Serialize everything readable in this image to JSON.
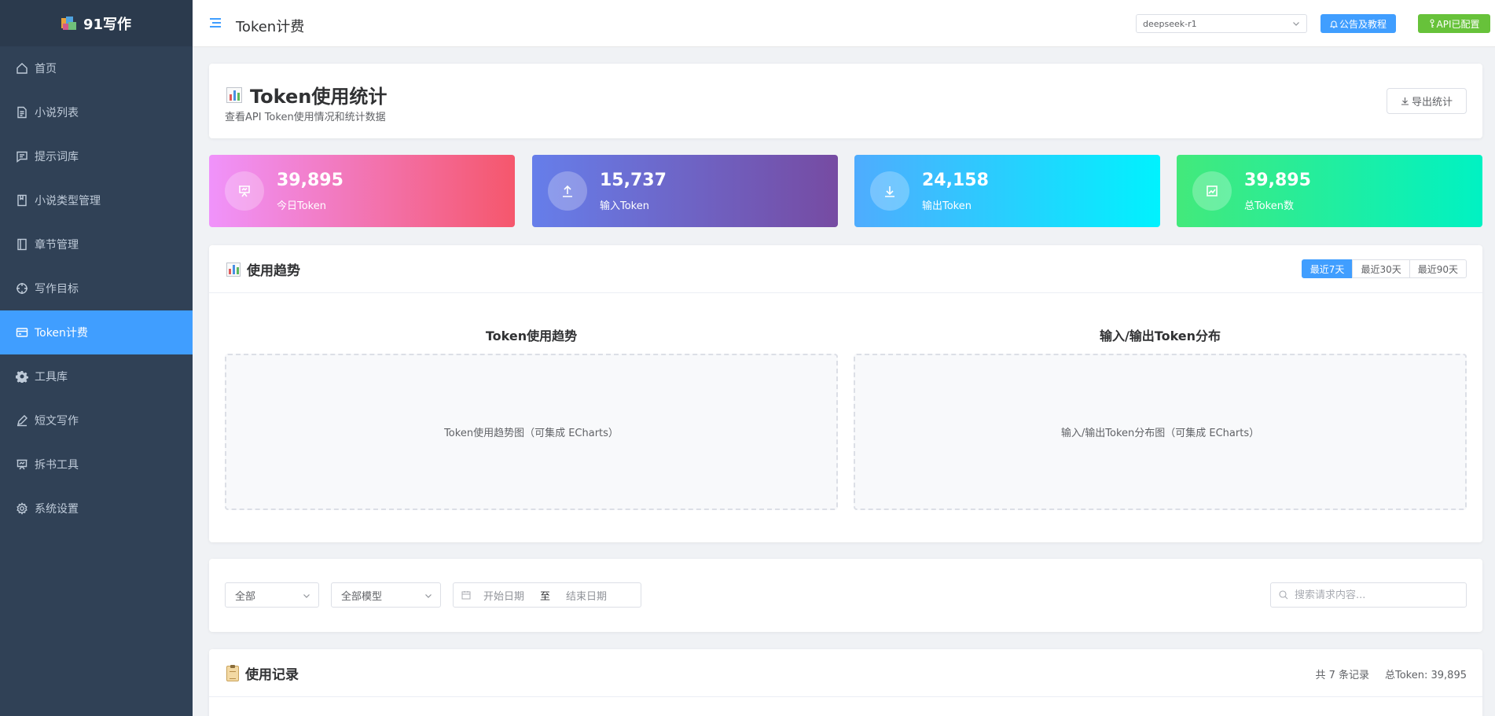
{
  "app": {
    "name": "91写作"
  },
  "sidebar": {
    "items": [
      {
        "label": "首页",
        "icon": "home-icon"
      },
      {
        "label": "小说列表",
        "icon": "document-icon"
      },
      {
        "label": "提示词库",
        "icon": "chat-icon"
      },
      {
        "label": "小说类型管理",
        "icon": "notebook-icon"
      },
      {
        "label": "章节管理",
        "icon": "book-icon"
      },
      {
        "label": "写作目标",
        "icon": "target-icon"
      },
      {
        "label": "Token计费",
        "icon": "credit-card-icon",
        "active": true
      },
      {
        "label": "工具库",
        "icon": "gear-icon"
      },
      {
        "label": "短文写作",
        "icon": "pen-icon"
      },
      {
        "label": "拆书工具",
        "icon": "presentation-icon"
      },
      {
        "label": "系统设置",
        "icon": "settings-icon"
      }
    ]
  },
  "header": {
    "title": "Token计费",
    "model_select": "deepseek-r1",
    "notice_button": "公告及教程",
    "api_button": "API已配置"
  },
  "hero": {
    "title": "Token使用统计",
    "subtitle": "查看API Token使用情况和统计数据",
    "export_button": "导出统计"
  },
  "stats": [
    {
      "value": "39,895",
      "label": "今日Token",
      "icon": "presentation-icon"
    },
    {
      "value": "15,737",
      "label": "输入Token",
      "icon": "upload-icon"
    },
    {
      "value": "24,158",
      "label": "输出Token",
      "icon": "download-icon"
    },
    {
      "value": "39,895",
      "label": "总Token数",
      "icon": "trend-chart-icon"
    }
  ],
  "trend": {
    "title": "使用趋势",
    "ranges": [
      "最近7天",
      "最近30天",
      "最近90天"
    ],
    "active_range": "最近7天",
    "left_chart": {
      "title": "Token使用趋势",
      "placeholder": "Token使用趋势图（可集成 ECharts）"
    },
    "right_chart": {
      "title": "输入/输出Token分布",
      "placeholder": "输入/输出Token分布图（可集成 ECharts）"
    }
  },
  "filters": {
    "type_select": "全部",
    "model_select": "全部模型",
    "start_date_placeholder": "开始日期",
    "date_separator": "至",
    "end_date_placeholder": "结束日期",
    "search_placeholder": "搜索请求内容..."
  },
  "records": {
    "title": "使用记录",
    "count_text": "共 7 条记录",
    "total_text": "总Token: 39,895"
  },
  "colors": {
    "sidebar_bg": "#304156",
    "active": "#409eff",
    "api_green": "#67c23a"
  }
}
